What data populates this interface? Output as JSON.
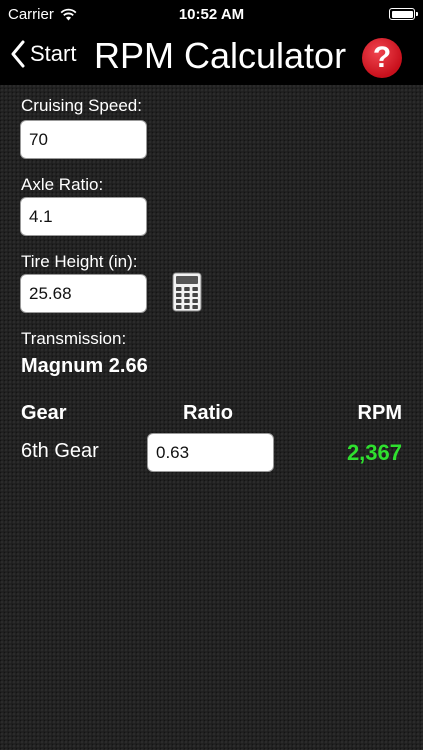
{
  "status_bar": {
    "carrier": "Carrier",
    "time": "10:52 AM"
  },
  "nav": {
    "back_label": "Start",
    "title": "RPM Calculator",
    "help_label": "?"
  },
  "form": {
    "cruising_speed": {
      "label": "Cruising Speed:",
      "value": "70"
    },
    "axle_ratio": {
      "label": "Axle Ratio:",
      "value": "4.1"
    },
    "tire_height": {
      "label": "Tire Height (in):",
      "value": "25.68"
    },
    "transmission": {
      "label": "Transmission:",
      "value": "Magnum 2.66"
    }
  },
  "table": {
    "headers": {
      "gear": "Gear",
      "ratio": "Ratio",
      "rpm": "RPM"
    },
    "rows": [
      {
        "gear": "6th Gear",
        "ratio": "0.63",
        "rpm": "2,367"
      }
    ]
  },
  "colors": {
    "help_button": "#d9222b",
    "rpm_value": "#2fe02f",
    "nav_background": "#000000"
  }
}
